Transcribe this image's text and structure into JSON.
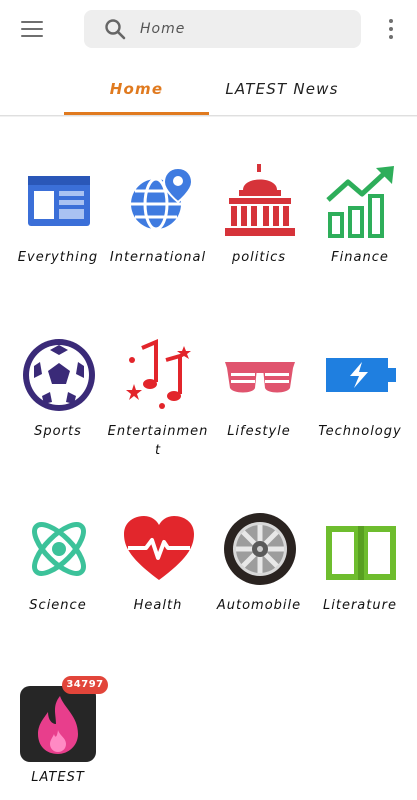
{
  "search": {
    "placeholder": "Home"
  },
  "tabs": [
    {
      "label": "Home",
      "active": true
    },
    {
      "label": "LATEST News",
      "active": false
    }
  ],
  "colors": {
    "accent": "#e07a1f",
    "badge": "#e2453a"
  },
  "categories": [
    {
      "label": "Everything",
      "icon": "newspaper-icon"
    },
    {
      "label": "International",
      "icon": "globe-location-icon"
    },
    {
      "label": "politics",
      "icon": "capitol-building-icon"
    },
    {
      "label": "Finance",
      "icon": "growth-chart-icon"
    },
    {
      "label": "Sports",
      "icon": "soccer-ball-icon"
    },
    {
      "label": "Entertainment",
      "icon": "music-notes-icon"
    },
    {
      "label": "Lifestyle",
      "icon": "shutter-glasses-icon"
    },
    {
      "label": "Technology",
      "icon": "charging-battery-icon"
    },
    {
      "label": "Science",
      "icon": "atom-icon"
    },
    {
      "label": "Health",
      "icon": "heartbeat-icon"
    },
    {
      "label": "Automobile",
      "icon": "car-wheel-icon"
    },
    {
      "label": "Literature",
      "icon": "open-book-icon"
    }
  ],
  "latest": {
    "label": "LATEST",
    "badge": "34797",
    "icon": "flame-icon"
  }
}
